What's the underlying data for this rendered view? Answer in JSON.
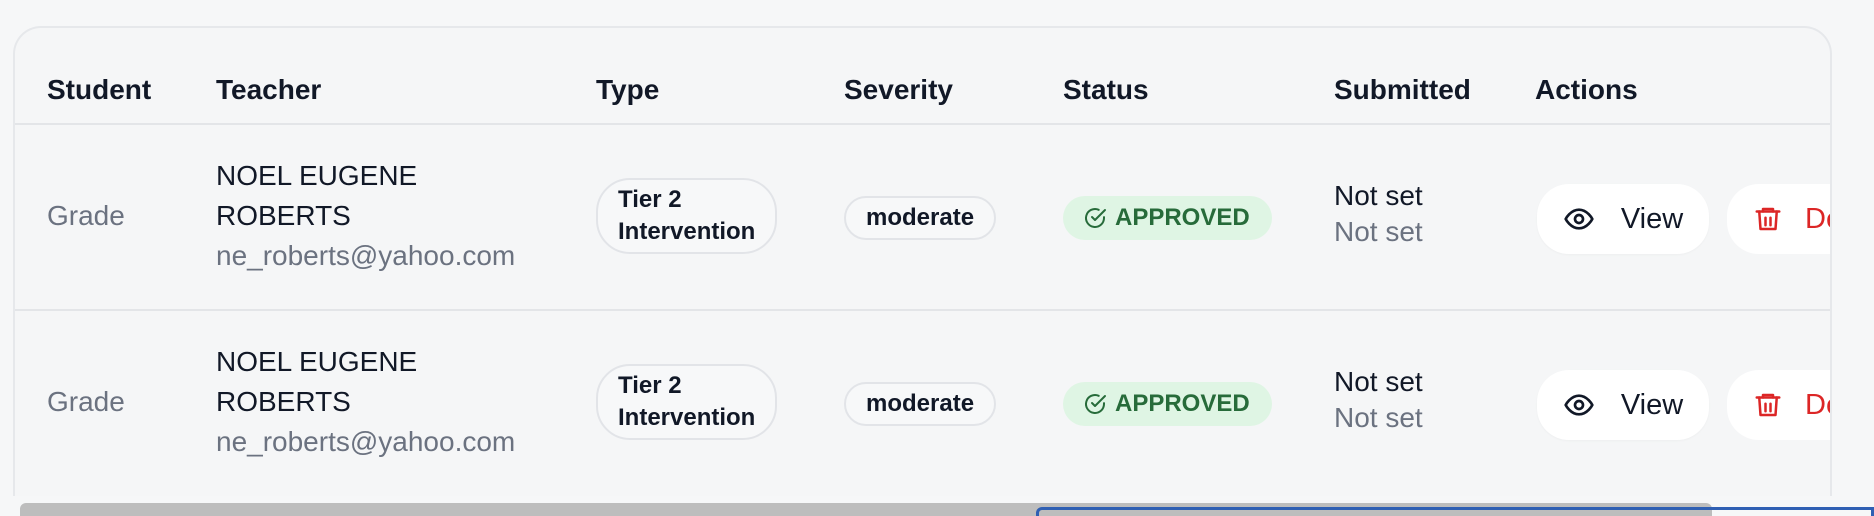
{
  "table": {
    "headers": [
      "Student",
      "Teacher",
      "Type",
      "Severity",
      "Status",
      "Submitted",
      "Actions"
    ],
    "rows": [
      {
        "student": "Grade",
        "teacher_name_line1": "NOEL EUGENE",
        "teacher_name_line2": "ROBERTS",
        "teacher_email": "ne_roberts@yahoo.com",
        "type_line1": "Tier 2",
        "type_line2": "Intervention",
        "severity": "moderate",
        "status": "APPROVED",
        "submitted_line1": "Not set",
        "submitted_line2": "Not set",
        "view_label": "View",
        "delete_label": "De"
      },
      {
        "student": "Grade",
        "teacher_name_line1": "NOEL EUGENE",
        "teacher_name_line2": "ROBERTS",
        "teacher_email": "ne_roberts@yahoo.com",
        "type_line1": "Tier 2",
        "type_line2": "Intervention",
        "severity": "moderate",
        "status": "APPROVED",
        "submitted_line1": "Not set",
        "submitted_line2": "Not set",
        "view_label": "View",
        "delete_label": "De"
      }
    ]
  },
  "colors": {
    "status_bg": "#dff5e4",
    "status_text": "#276b3a",
    "delete": "#dc2626"
  },
  "icons": {
    "status": "check-circle-icon",
    "view": "eye-icon",
    "delete": "trash-icon"
  }
}
